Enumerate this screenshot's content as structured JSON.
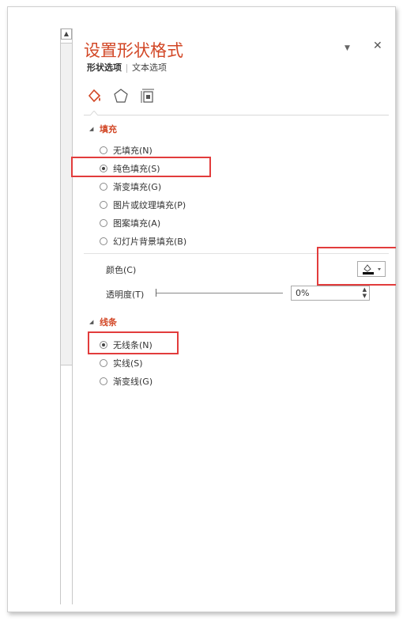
{
  "panel": {
    "title": "设置形状格式",
    "tab_shape": "形状选项",
    "tab_text": "文本选项",
    "pin_glyph": "▼",
    "close_glyph": "✕"
  },
  "fill": {
    "section_label": "填充",
    "options": [
      {
        "label": "无填充(N)",
        "selected": false
      },
      {
        "label": "纯色填充(S)",
        "selected": true
      },
      {
        "label": "渐变填充(G)",
        "selected": false
      },
      {
        "label": "图片或纹理填充(P)",
        "selected": false
      },
      {
        "label": "图案填充(A)",
        "selected": false
      },
      {
        "label": "幻灯片背景填充(B)",
        "selected": false
      }
    ],
    "color_label": "颜色(C)",
    "transparency_label": "透明度(T)",
    "transparency_value": "0%"
  },
  "line": {
    "section_label": "线条",
    "options": [
      {
        "label": "无线条(N)",
        "selected": true
      },
      {
        "label": "实线(S)",
        "selected": false
      },
      {
        "label": "渐变线(G)",
        "selected": false
      }
    ]
  },
  "colors": {
    "accent": "#d24726",
    "highlight": "#e23c3c"
  }
}
